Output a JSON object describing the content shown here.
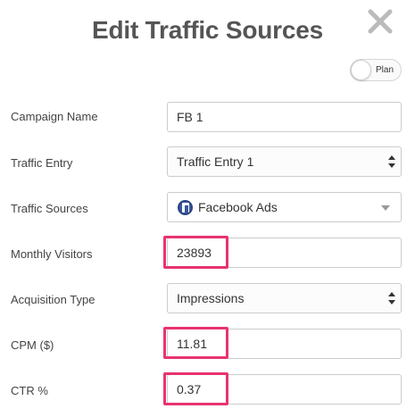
{
  "modal": {
    "title": "Edit Traffic Sources",
    "plan_toggle_label": "Plan"
  },
  "form": {
    "campaign_name": {
      "label": "Campaign Name",
      "value": "FB 1"
    },
    "traffic_entry": {
      "label": "Traffic Entry",
      "value": "Traffic Entry 1"
    },
    "traffic_sources": {
      "label": "Traffic Sources",
      "value": "Facebook Ads",
      "icon": "facebook-icon"
    },
    "monthly_visitors": {
      "label": "Monthly Visitors",
      "value": "23893"
    },
    "acquisition_type": {
      "label": "Acquisition Type",
      "value": "Impressions"
    },
    "cpm": {
      "label": "CPM ($)",
      "value": "11.81"
    },
    "ctr": {
      "label": "CTR %",
      "value": "0.37"
    }
  },
  "colors": {
    "highlight": "#e8336f",
    "title": "#555555",
    "facebook": "#3b5998"
  }
}
